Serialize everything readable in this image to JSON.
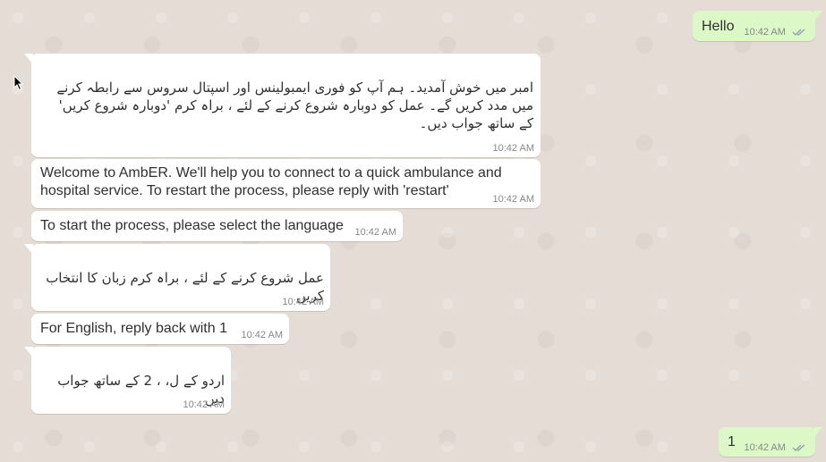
{
  "messages": [
    {
      "text": "Hello",
      "time": "10:42 AM",
      "direction": "out"
    },
    {
      "text": "امبر میں خوش آمدید۔ ہم آپ کو فوری ایمبولینس اور اسپتال سروس سے رابطہ کرنے میں مدد کریں گے۔ عمل کو دوبارہ شروع کرنے کے لئے ، براہ کرم 'دوبارہ شروع کریں' کے ساتھ جواب دیں۔",
      "time": "10:42 AM",
      "direction": "in"
    },
    {
      "text": "Welcome to AmbER. We'll help you to connect to a quick ambulance and hospital service. To restart the process, please reply with 'restart'",
      "time": "10:42 AM",
      "direction": "in"
    },
    {
      "text": "To start the process, please select the language",
      "time": "10:42 AM",
      "direction": "in"
    },
    {
      "text": "عمل شروع کرنے کے لئے ، براہ کرم زبان کا انتخاب کریں",
      "time": "10:42 AM",
      "direction": "in"
    },
    {
      "text": "For English, reply back with 1",
      "time": "10:42 AM",
      "direction": "in"
    },
    {
      "text": "اردو کے ل، ، 2 کے ساتھ جواب دیں",
      "time": "10:42 AM",
      "direction": "in"
    },
    {
      "text": "1",
      "time": "10:42 AM",
      "direction": "out"
    }
  ],
  "colors": {
    "chat_background": "#e5ddd5",
    "incoming_bubble": "#ffffff",
    "outgoing_bubble": "#dcf8c6",
    "read_check": "#4fc3f7"
  },
  "icons": {
    "read_receipt": "double-check-icon",
    "pointer": "mouse-cursor-icon"
  }
}
